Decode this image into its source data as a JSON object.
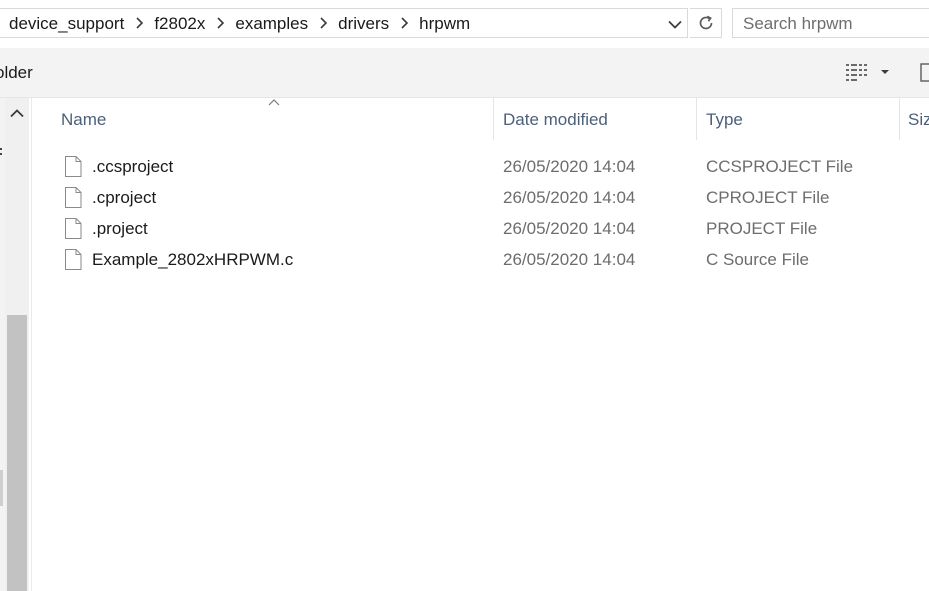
{
  "address_bar": {
    "breadcrumbs": [
      "device_support",
      "f2802x",
      "examples",
      "drivers",
      "hrpwm"
    ]
  },
  "search": {
    "placeholder": "Search hrpwm"
  },
  "command_bar": {
    "partial_label": "older"
  },
  "columns": [
    {
      "label": "Name"
    },
    {
      "label": "Date modified"
    },
    {
      "label": "Type"
    },
    {
      "label": "Siz"
    }
  ],
  "files": [
    {
      "name": ".ccsproject",
      "date": "26/05/2020 14:04",
      "type": "CCSPROJECT File"
    },
    {
      "name": ".cproject",
      "date": "26/05/2020 14:04",
      "type": "CPROJECT File"
    },
    {
      "name": ".project",
      "date": "26/05/2020 14:04",
      "type": "PROJECT File"
    },
    {
      "name": "Example_2802xHRPWM.c",
      "date": "26/05/2020 14:04",
      "type": "C Source File"
    }
  ],
  "icons": {
    "breadcrumb_separator": "chevron-right-icon",
    "address_dropdown": "chevron-down-icon",
    "refresh": "refresh-icon",
    "view_toggle": "details-view-icon",
    "file": "file-icon",
    "sort": "sort-ascending-icon"
  },
  "colors": {
    "header_text": "#4c607a",
    "secondary_text": "#6d6d6d",
    "command_bar_bg": "#f3f3f3"
  }
}
